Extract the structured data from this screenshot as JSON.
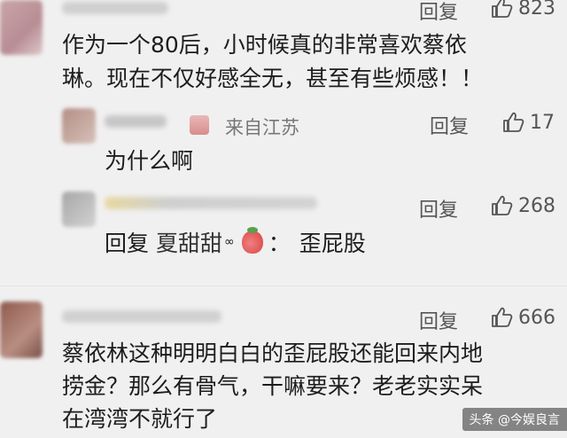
{
  "comments": [
    {
      "likes": "823",
      "reply_label": "回复",
      "lines": [
        "作为一个80后，小时候真的非常喜欢蔡依",
        "琳。现在不仅好感全无，甚至有些烦感！！"
      ]
    },
    {
      "from": "来自江苏",
      "likes": "17",
      "reply_label": "回复",
      "lines": [
        "为什么啊"
      ]
    },
    {
      "likes": "268",
      "reply_label": "回复",
      "reply_prefix": "回复",
      "reply_to": "夏甜甜",
      "reply_body": "歪屁股"
    },
    {
      "likes": "666",
      "reply_label": "回复",
      "lines": [
        "蔡依林这种明明白白的歪屁股还能回来内地",
        "捞金？那么有骨气，干嘛要来？老老实实呆",
        "在湾湾不就行了"
      ]
    }
  ],
  "watermark": "头条 @今娱良言"
}
